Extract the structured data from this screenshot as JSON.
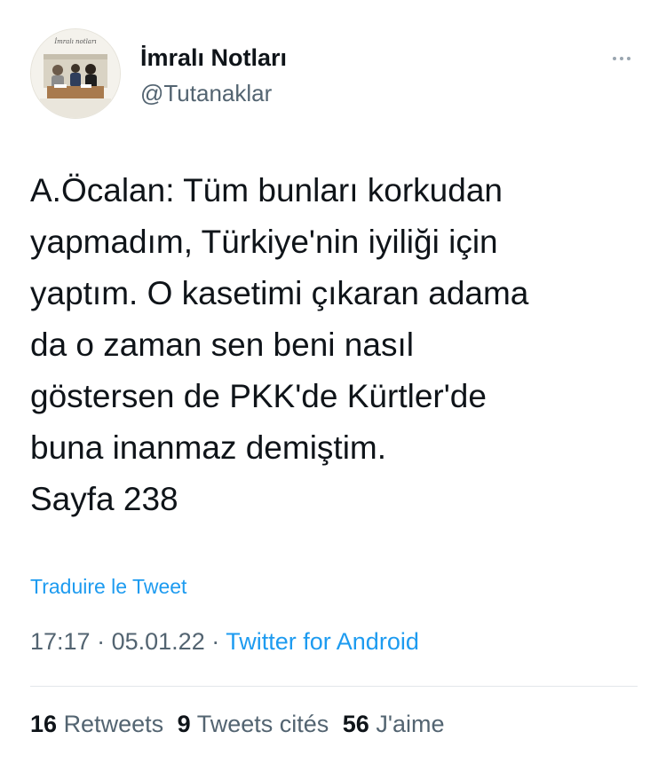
{
  "author": {
    "name": "İmralı Notları",
    "handle": "@Tutanaklar",
    "avatar_caption": "İmralı notları"
  },
  "tweet": {
    "lines": [
      "A.Öcalan: Tüm bunları korkudan",
      "yapmadım, Türkiye'nin iyiliği için",
      "yaptım. O kasetimi çıkaran adama",
      "da o zaman sen beni nasıl",
      "göstersen de PKK'de Kürtler'de",
      "buna inanmaz demiştim.",
      "Sayfa 238"
    ],
    "translate_label": "Traduire le Tweet",
    "time": "17:17",
    "date": "05.01.22",
    "separator": "·",
    "source": "Twitter for Android"
  },
  "stats": {
    "retweets_count": "16",
    "retweets_label": "Retweets",
    "quotes_count": "9",
    "quotes_label": "Tweets cités",
    "likes_count": "56",
    "likes_label": "J'aime"
  },
  "icons": {
    "more": "more-horizontal-icon"
  },
  "colors": {
    "text": "#0f1419",
    "secondary": "#536471",
    "link": "#1d9bf0",
    "divider": "#e3e7ea"
  }
}
